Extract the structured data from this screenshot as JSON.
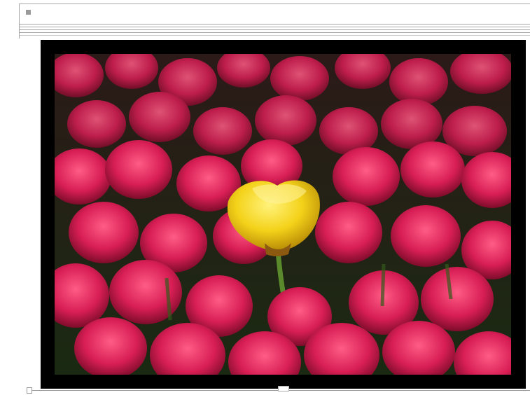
{
  "toolbar": {
    "square_icon": "small-square-icon"
  },
  "image": {
    "subject_icon": "tulip-photo-icon",
    "colors": {
      "frame": "#000000",
      "tulip_pink": "#d81e55",
      "tulip_pink_dark": "#8f0f33",
      "tulip_yellow": "#f4d21a",
      "stem_green": "#5b8a2d",
      "background_green": "#1a2a12"
    }
  },
  "handles": {
    "left_icon": "resize-handle-icon",
    "center_icon": "resize-handle-icon"
  }
}
